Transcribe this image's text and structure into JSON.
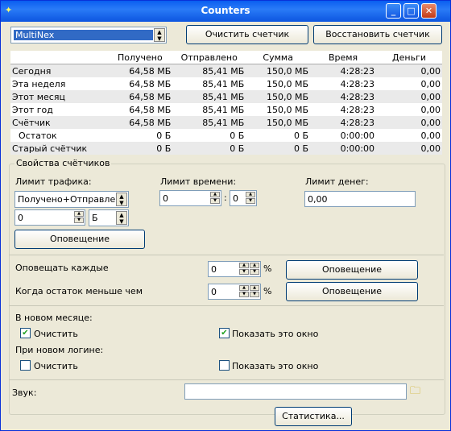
{
  "window": {
    "title": "Counters"
  },
  "toolbar": {
    "connection": "MultiNex",
    "clear_label": "Очистить счетчик",
    "restore_label": "Восстановить счетчик"
  },
  "table": {
    "headers": [
      "",
      "Получено",
      "Отправлено",
      "Сумма",
      "Время",
      "Деньги"
    ],
    "rows": [
      [
        "Сегодня",
        "64,58 МБ",
        "85,41 МБ",
        "150,0 МБ",
        "4:28:23",
        "0,00"
      ],
      [
        "Эта неделя",
        "64,58 МБ",
        "85,41 МБ",
        "150,0 МБ",
        "4:28:23",
        "0,00"
      ],
      [
        "Этот месяц",
        "64,58 МБ",
        "85,41 МБ",
        "150,0 МБ",
        "4:28:23",
        "0,00"
      ],
      [
        "Этот год",
        "64,58 МБ",
        "85,41 МБ",
        "150,0 МБ",
        "4:28:23",
        "0,00"
      ],
      [
        "Счётчик",
        "64,58 МБ",
        "85,41 МБ",
        "150,0 МБ",
        "4:28:23",
        "0,00"
      ],
      [
        "  Остаток",
        "0 Б",
        "0 Б",
        "0 Б",
        "0:00:00",
        "0,00"
      ],
      [
        "Старый счётчик",
        "0 Б",
        "0 Б",
        "0 Б",
        "0:00:00",
        "0,00"
      ]
    ]
  },
  "props": {
    "legend": "Свойства счётчиков",
    "traffic_limit_label": "Лимит трафика:",
    "traffic_mode": "Получено+Отправлено",
    "traffic_value": "0",
    "traffic_unit": "Б",
    "notify_label": "Оповещение",
    "time_limit_label": "Лимит времени:",
    "time_hours": "0",
    "time_sep": ":",
    "time_minutes": "0",
    "money_limit_label": "Лимит денег:",
    "money_value": "0,00",
    "notify_every_label": "Оповещать каждые",
    "notify_every_value": "0",
    "percent": "%",
    "remainder_label": "Когда остаток меньше чем",
    "remainder_value": "0",
    "new_month_label": "В новом месяце:",
    "clear_label": "Очистить",
    "show_window_label": "Показать это окно",
    "new_login_label": "При новом логине:",
    "sound_label": "Звук:",
    "sound_value": "",
    "stats_button": "Статистика..."
  }
}
